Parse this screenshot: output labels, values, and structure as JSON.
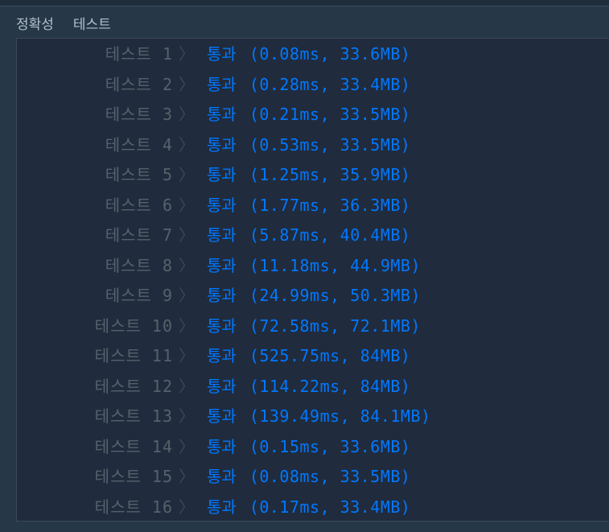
{
  "header": {
    "tab_accuracy": "정확성",
    "tab_test": "테스트"
  },
  "tests": [
    {
      "label": "테스트 1",
      "status": "통과",
      "result": "(0.08ms, 33.6MB)"
    },
    {
      "label": "테스트 2",
      "status": "통과",
      "result": "(0.28ms, 33.4MB)"
    },
    {
      "label": "테스트 3",
      "status": "통과",
      "result": "(0.21ms, 33.5MB)"
    },
    {
      "label": "테스트 4",
      "status": "통과",
      "result": "(0.53ms, 33.5MB)"
    },
    {
      "label": "테스트 5",
      "status": "통과",
      "result": "(1.25ms, 35.9MB)"
    },
    {
      "label": "테스트 6",
      "status": "통과",
      "result": "(1.77ms, 36.3MB)"
    },
    {
      "label": "테스트 7",
      "status": "통과",
      "result": "(5.87ms, 40.4MB)"
    },
    {
      "label": "테스트 8",
      "status": "통과",
      "result": "(11.18ms, 44.9MB)"
    },
    {
      "label": "테스트 9",
      "status": "통과",
      "result": "(24.99ms, 50.3MB)"
    },
    {
      "label": "테스트 10",
      "status": "통과",
      "result": "(72.58ms, 72.1MB)"
    },
    {
      "label": "테스트 11",
      "status": "통과",
      "result": "(525.75ms, 84MB)"
    },
    {
      "label": "테스트 12",
      "status": "통과",
      "result": "(114.22ms, 84MB)"
    },
    {
      "label": "테스트 13",
      "status": "통과",
      "result": "(139.49ms, 84.1MB)"
    },
    {
      "label": "테스트 14",
      "status": "통과",
      "result": "(0.15ms, 33.6MB)"
    },
    {
      "label": "테스트 15",
      "status": "통과",
      "result": "(0.08ms, 33.5MB)"
    },
    {
      "label": "테스트 16",
      "status": "통과",
      "result": "(0.17ms, 33.4MB)"
    }
  ],
  "icons": {
    "row_chevron": "chevron-right-icon"
  },
  "colors": {
    "background": "#263747",
    "panel": "#202b3d",
    "label": "#57616c",
    "pass": "#0078ff"
  }
}
